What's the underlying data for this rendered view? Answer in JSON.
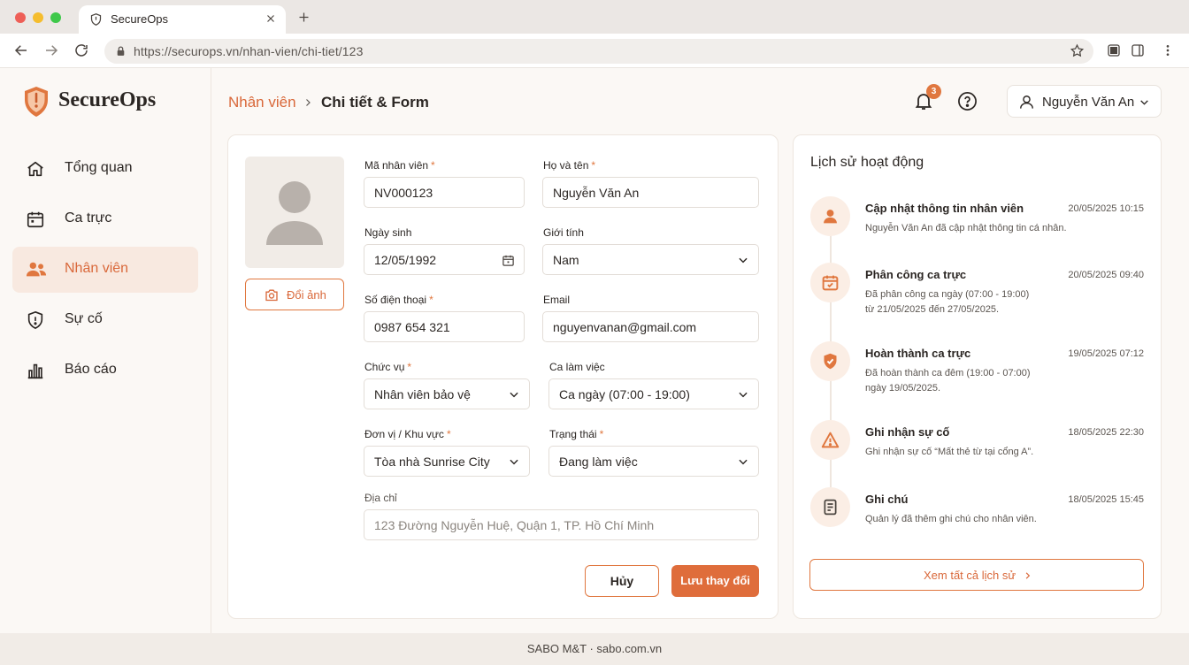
{
  "browser": {
    "tab_title": "SecureOps",
    "url": "https://securops.vn/nhan-vien/chi-tiet/123"
  },
  "sidebar": {
    "logo_text": "SecureOps",
    "items": [
      {
        "label": "Tổng quan",
        "icon": "home-icon",
        "active": false
      },
      {
        "label": "Ca trực",
        "icon": "calendar-icon",
        "active": false
      },
      {
        "label": "Nhân viên",
        "icon": "users-icon",
        "active": true
      },
      {
        "label": "Sự cố",
        "icon": "shield-alert-icon",
        "active": false
      },
      {
        "label": "Báo cáo",
        "icon": "bar-chart-icon",
        "active": false
      }
    ]
  },
  "header": {
    "breadcrumb_parent": "Nhân viên",
    "breadcrumb_current": "Chi tiết & Form",
    "notification_count": "3",
    "user_name": "Nguyễn Văn An"
  },
  "form": {
    "change_photo": "Đổi ảnh",
    "employee_id": {
      "label": "Mã nhân viên",
      "value": "NV000123",
      "required": true
    },
    "full_name": {
      "label": "Họ và tên",
      "value": "Nguyễn Văn An",
      "required": true
    },
    "dob": {
      "label": "Ngày sinh",
      "value": "12/05/1992"
    },
    "gender": {
      "label": "Giới tính",
      "value": "Nam"
    },
    "phone": {
      "label": "Số điện thoại",
      "value": "0987 654 321",
      "required": true
    },
    "email": {
      "label": "Email",
      "value": "nguyenvanan@gmail.com"
    },
    "position": {
      "label": "Chức vụ",
      "value": "Nhân viên bảo vệ",
      "required": true
    },
    "shift": {
      "label": "Ca làm việc",
      "value": "Ca ngày (07:00 - 19:00)"
    },
    "unit": {
      "label": "Đơn vị / Khu vực",
      "value": "Tòa nhà Sunrise City",
      "required": true
    },
    "status": {
      "label": "Trạng thái",
      "value": "Đang làm việc",
      "required": true
    },
    "address": {
      "label": "Địa chỉ",
      "placeholder": "123 Đường Nguyễn Huệ, Quận 1, TP. Hồ Chí Minh"
    },
    "cancel_label": "Hủy",
    "save_label": "Lưu thay đổi"
  },
  "activity": {
    "title": "Lịch sử hoạt động",
    "items": [
      {
        "icon": "user-icon",
        "name": "Cập nhật thông tin nhân viên",
        "time": "20/05/2025 10:15",
        "desc": [
          "Nguyễn Văn An đã cập nhật thông tin cá nhân."
        ]
      },
      {
        "icon": "calendar-check-icon",
        "name": "Phân công ca trực",
        "time": "20/05/2025 09:40",
        "desc": [
          "Đã phân công ca ngày (07:00 - 19:00)",
          "từ 21/05/2025 đến 27/05/2025."
        ]
      },
      {
        "icon": "shield-check-icon",
        "name": "Hoàn thành ca trực",
        "time": "19/05/2025 07:12",
        "desc": [
          "Đã hoàn thành ca đêm (19:00 - 07:00)",
          "ngày 19/05/2025."
        ]
      },
      {
        "icon": "warning-icon",
        "name": "Ghi nhận sự cố",
        "time": "18/05/2025 22:30",
        "desc": [
          "Ghi nhận sự cố “Mất thẻ từ tại cổng A”."
        ]
      },
      {
        "icon": "note-icon",
        "name": "Ghi chú",
        "time": "18/05/2025 15:45",
        "desc": [
          "Quản lý đã thêm ghi chú cho nhân viên."
        ]
      }
    ],
    "view_all": "Xem tất cả lịch sử"
  },
  "footer": {
    "text": "SABO M&T · sabo.com.vn"
  },
  "colors": {
    "accent": "#df6d3b",
    "active_bg": "#f8e9e0",
    "icon_bg": "#fbeee5"
  }
}
